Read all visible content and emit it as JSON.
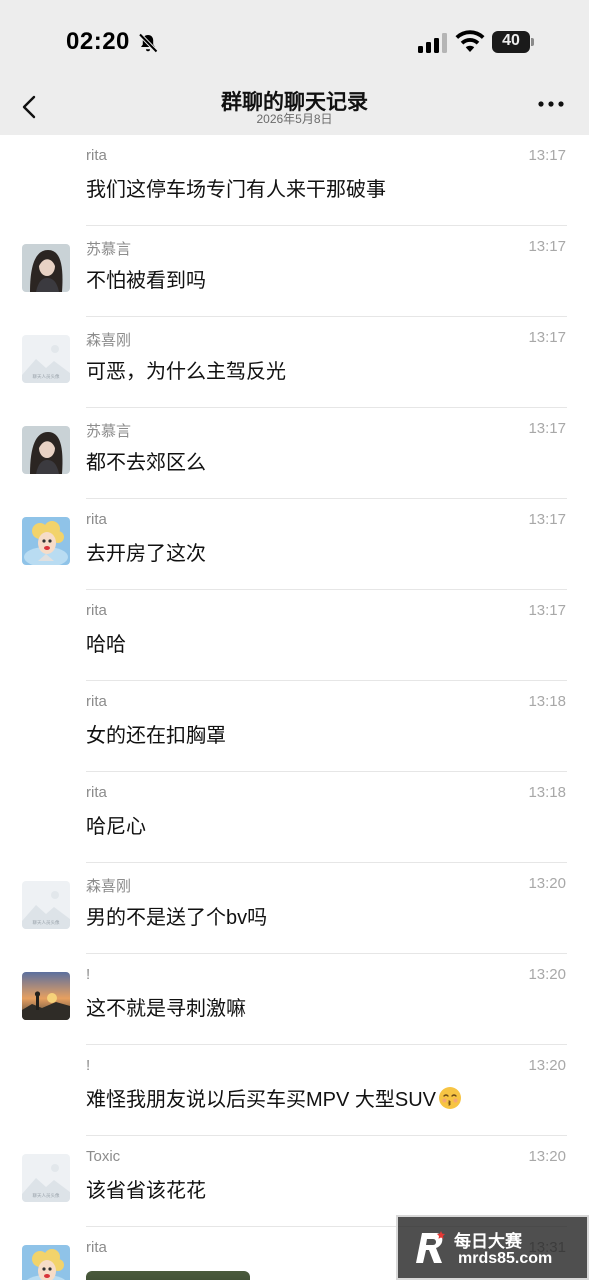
{
  "status_bar": {
    "time": "02:20",
    "battery": "40"
  },
  "header": {
    "title": "群聊的聊天记录",
    "date": "2026年5月8日"
  },
  "placeholder_caption": "聊天人员头像",
  "messages": [
    {
      "sender": "rita",
      "time": "13:17",
      "text": "我们这停车场专门有人来干那破事",
      "avatar": "none"
    },
    {
      "sender": "苏慕言",
      "time": "13:17",
      "text": "不怕被看到吗",
      "avatar": "girl-photo"
    },
    {
      "sender": "森喜刚",
      "time": "13:17",
      "text": "可恶，为什么主驾反光",
      "avatar": "placeholder"
    },
    {
      "sender": "苏慕言",
      "time": "13:17",
      "text": "都不去郊区么",
      "avatar": "girl-photo"
    },
    {
      "sender": "rita",
      "time": "13:17",
      "text": "去开房了这次",
      "avatar": "cartoon-blonde"
    },
    {
      "sender": "rita",
      "time": "13:17",
      "text": "哈哈",
      "avatar": "none"
    },
    {
      "sender": "rita",
      "time": "13:18",
      "text": "女的还在扣胸罩",
      "avatar": "none"
    },
    {
      "sender": "rita",
      "time": "13:18",
      "text": "哈尼心",
      "avatar": "none"
    },
    {
      "sender": "森喜刚",
      "time": "13:20",
      "text": "男的不是送了个bv吗",
      "avatar": "placeholder"
    },
    {
      "sender": "!",
      "time": "13:20",
      "text": "这不就是寻刺激嘛",
      "avatar": "sunset-photo"
    },
    {
      "sender": "!",
      "time": "13:20",
      "text": "难怪我朋友说以后买车买MPV 大型SUV",
      "avatar": "none",
      "emoji": "kissing-face-emoji"
    },
    {
      "sender": "Toxic",
      "time": "13:20",
      "text": "该省省该花花",
      "avatar": "placeholder"
    },
    {
      "sender": "rita",
      "time": "13:31",
      "text": "",
      "avatar": "cartoon-blonde",
      "image": true
    }
  ],
  "watermark": {
    "title": "每日大赛",
    "url": "mrds85.com"
  }
}
